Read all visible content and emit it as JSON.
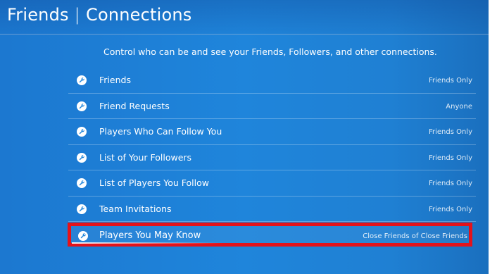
{
  "header": {
    "title_part1": "Friends",
    "title_part2": "Connections"
  },
  "description": "Control who can be and see your Friends, Followers, and other connections.",
  "settings": [
    {
      "label": "Friends",
      "value": "Friends Only",
      "icon": "wrench-icon"
    },
    {
      "label": "Friend Requests",
      "value": "Anyone",
      "icon": "wrench-icon"
    },
    {
      "label": "Players Who Can Follow You",
      "value": "Friends Only",
      "icon": "wrench-icon"
    },
    {
      "label": "List of Your Followers",
      "value": "Friends Only",
      "icon": "wrench-icon"
    },
    {
      "label": "List of Players You Follow",
      "value": "Friends Only",
      "icon": "wrench-icon"
    },
    {
      "label": "Team Invitations",
      "value": "Friends Only",
      "icon": "wrench-icon"
    },
    {
      "label": "Players You May Know",
      "value": "Close Friends of Close Friends",
      "icon": "wrench-icon",
      "selected": true
    }
  ],
  "colors": {
    "background": "#1f85db",
    "text": "#ffffff",
    "highlight_border": "#e3131b"
  }
}
